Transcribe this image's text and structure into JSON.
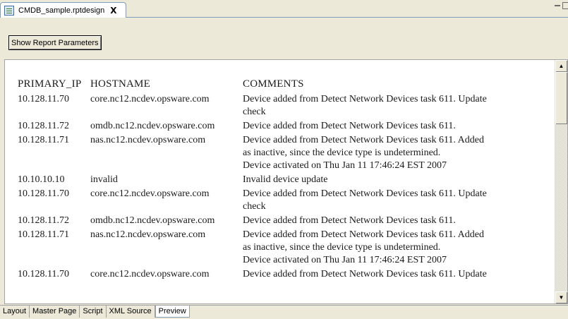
{
  "editor_tab": {
    "title": "CMDB_sample.rptdesign",
    "close_glyph": "X"
  },
  "toolbar": {
    "show_params_label": "Show Report Parameters"
  },
  "report": {
    "headers": {
      "primary_ip": "PRIMARY_IP",
      "hostname": "HOSTNAME",
      "comments": "COMMENTS"
    },
    "rows": [
      {
        "ip": "10.128.11.70",
        "host": "core.nc12.ncdev.opsware.com",
        "comments": [
          "Device added from Detect Network Devices task 611. Update",
          "check"
        ]
      },
      {
        "ip": "10.128.11.72",
        "host": "omdb.nc12.ncdev.opsware.com",
        "comments": [
          "Device added from Detect Network Devices task 611."
        ]
      },
      {
        "ip": "10.128.11.71",
        "host": "nas.nc12.ncdev.opsware.com",
        "comments": [
          "Device added from Detect Network Devices task 611. Added",
          "as inactive, since the device type is undetermined.",
          "Device activated on Thu Jan 11 17:46:24 EST 2007"
        ]
      },
      {
        "ip": "10.10.10.10",
        "host": "invalid",
        "comments": [
          "Invalid device update"
        ]
      },
      {
        "ip": "10.128.11.70",
        "host": "core.nc12.ncdev.opsware.com",
        "comments": [
          "Device added from Detect Network Devices task 611. Update",
          "check"
        ]
      },
      {
        "ip": "10.128.11.72",
        "host": "omdb.nc12.ncdev.opsware.com",
        "comments": [
          "Device added from Detect Network Devices task 611."
        ]
      },
      {
        "ip": "10.128.11.71",
        "host": "nas.nc12.ncdev.opsware.com",
        "comments": [
          "Device added from Detect Network Devices task 611. Added",
          "as inactive, since the device type is undetermined.",
          "Device activated on Thu Jan 11 17:46:24 EST 2007"
        ]
      },
      {
        "ip": "10.128.11.70",
        "host": "core.nc12.ncdev.opsware.com",
        "comments": [
          "Device added from Detect Network Devices task 611. Update"
        ]
      }
    ]
  },
  "bottom_tabs": [
    {
      "label": "Layout",
      "active": false
    },
    {
      "label": "Master Page",
      "active": false
    },
    {
      "label": "Script",
      "active": false
    },
    {
      "label": "XML Source",
      "active": false
    },
    {
      "label": "Preview",
      "active": true
    }
  ],
  "colors": {
    "chrome": "#ece9d8",
    "tab_border": "#7f9db9",
    "text": "#1a1a1a"
  },
  "icons": {
    "tab_icon": "report-design-icon",
    "scroll_up": "scroll-up-arrow-icon",
    "scroll_down": "scroll-down-arrow-icon"
  }
}
